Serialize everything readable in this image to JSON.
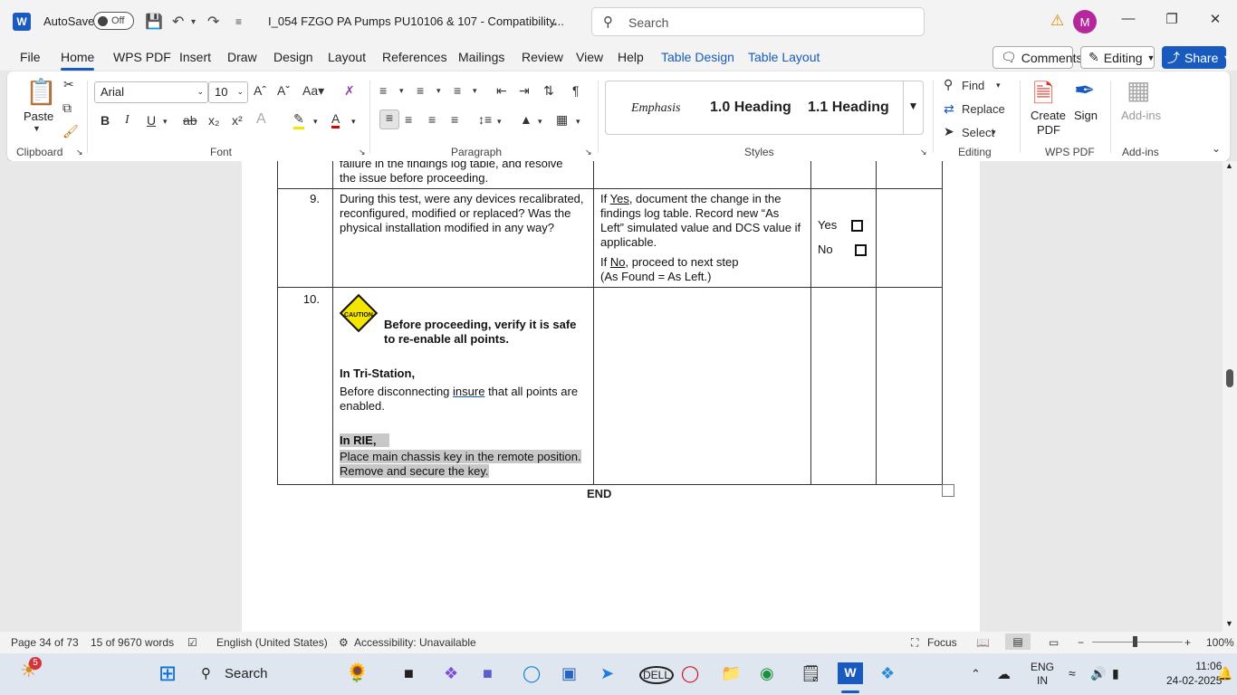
{
  "titlebar": {
    "app_icon_letter": "W",
    "autosave_label": "AutoSave",
    "autosave_state": "Off",
    "doc_title": "I_054 FZGO PA Pumps PU10106 & 107  -  Compatibility...",
    "search_placeholder": "Search",
    "avatar_initial": "M"
  },
  "menu": {
    "tabs": [
      "File",
      "Home",
      "WPS PDF",
      "Insert",
      "Draw",
      "Design",
      "Layout",
      "References",
      "Mailings",
      "Review",
      "View",
      "Help",
      "Table Design",
      "Table Layout"
    ],
    "active_tab": "Home",
    "comments_label": "Comments",
    "editing_label": "Editing",
    "share_label": "Share"
  },
  "ribbon": {
    "clipboard": {
      "paste_label": "Paste",
      "group_label": "Clipboard"
    },
    "font": {
      "family": "Arial",
      "size": "10",
      "group_label": "Font"
    },
    "paragraph": {
      "group_label": "Paragraph"
    },
    "styles": {
      "emphasis": "Emphasis",
      "h10": "1.0  Heading",
      "h11": "1.1  Heading",
      "group_label": "Styles"
    },
    "editing": {
      "find": "Find",
      "replace": "Replace",
      "select": "Select",
      "group_label": "Editing"
    },
    "wps": {
      "create_pdf_1": "Create",
      "create_pdf_2": "PDF",
      "sign": "Sign",
      "group_label": "WPS PDF"
    },
    "addins": {
      "label": "Add-ins",
      "group_label": "Add-ins"
    }
  },
  "document": {
    "row8_tail": {
      "line1": "failure in the findings log table, and resolve",
      "line2": "the issue before proceeding."
    },
    "row9": {
      "num": "9.",
      "question": "During this test, were any devices recalibrated, reconfigured, modified or replaced? Was the physical installation modified in any way?",
      "yes_prefix": "If ",
      "yes_word": "Yes",
      "yes_rest": ", document the change in the findings log table. Record new “As Left” simulated value and DCS value if applicable.",
      "no_prefix": "If ",
      "no_word": "No",
      "no_rest": ", proceed to next step",
      "no_line2": "(As Found = As Left.)",
      "opt_yes": "Yes",
      "opt_no": "No"
    },
    "row10": {
      "num": "10.",
      "caution_text": "CAUTION",
      "caution_heading": "Before proceeding, verify it is safe to re-enable all points.",
      "tri_heading": "In Tri-Station,",
      "tri_text_a": "Before disconnecting ",
      "tri_text_u": "insure",
      "tri_text_b": " that all points are enabled.",
      "rie_heading": "In RIE,",
      "rie_line1": "Place main chassis key in the remote position.",
      "rie_line2": "Remove and secure the key."
    },
    "end_label": "END"
  },
  "statusbar": {
    "page": "Page 34 of 73",
    "words": "15 of 9670 words",
    "language": "English (United States)",
    "accessibility": "Accessibility: Unavailable",
    "focus": "Focus",
    "zoom": "100%"
  },
  "taskbar": {
    "badge": "5",
    "search_label": "Search",
    "lang1": "ENG",
    "lang2": "IN",
    "time": "11:06",
    "date": "24-02-2025"
  }
}
